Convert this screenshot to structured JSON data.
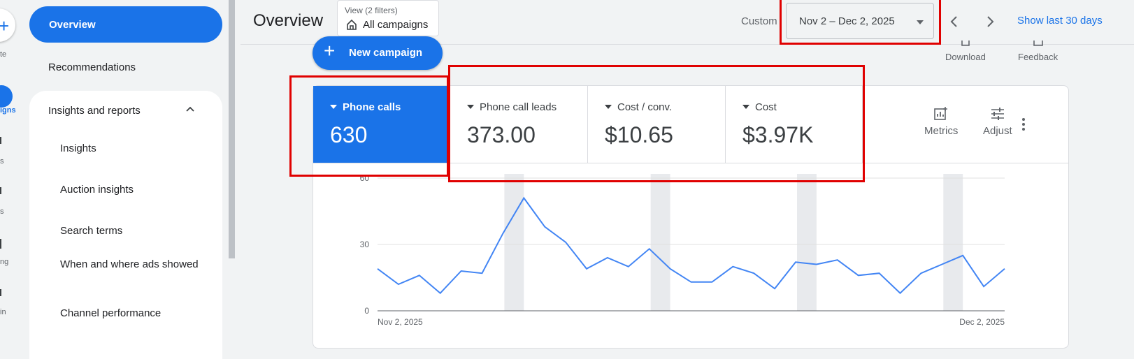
{
  "rail": {
    "create_label": "te",
    "campaigns_label": "igns",
    "items": [
      "s",
      "s",
      "ng",
      "in"
    ]
  },
  "sidenav": {
    "overview": "Overview",
    "recommendations": "Recommendations",
    "group": "Insights and reports",
    "subitems": [
      "Insights",
      "Auction insights",
      "Search terms",
      "When and where ads showed",
      "Channel performance"
    ]
  },
  "header": {
    "title": "Overview",
    "view_key": "View (2 filters)",
    "view_value": "All campaigns",
    "custom_label": "Custom",
    "date_range": "Nov 2 – Dec 2, 2025",
    "show_last": "Show last 30 days"
  },
  "toolbar": {
    "new_campaign": "New campaign",
    "download": "Download",
    "feedback": "Feedback"
  },
  "metrics": [
    {
      "name": "Phone calls",
      "value": "630"
    },
    {
      "name": "Phone call leads",
      "value": "373.00"
    },
    {
      "name": "Cost / conv.",
      "value": "$10.65"
    },
    {
      "name": "Cost",
      "value": "$3.97K"
    }
  ],
  "card_tools": {
    "metrics": "Metrics",
    "adjust": "Adjust"
  },
  "colors": {
    "accent": "#1a73e8",
    "highlight": "#e00000",
    "line": "#4285f4",
    "weekend_band": "#e8eaed"
  },
  "chart_data": {
    "type": "line",
    "series": [
      {
        "name": "Phone calls",
        "values": [
          19,
          12,
          16,
          8,
          18,
          17,
          35,
          51,
          38,
          31,
          19,
          24,
          20,
          28,
          19,
          13,
          13,
          20,
          17,
          10,
          22,
          21,
          23,
          16,
          17,
          8,
          17,
          21,
          25,
          11,
          19
        ]
      }
    ],
    "x_start_label": "Nov 2, 2025",
    "x_end_label": "Dec 2, 2025",
    "y_ticks": [
      "0",
      "30",
      "60"
    ],
    "ylim": [
      0,
      60
    ],
    "highlight_bands": [
      6,
      13,
      20,
      27
    ],
    "grid": true
  }
}
